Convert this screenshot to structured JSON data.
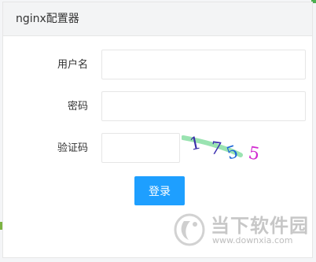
{
  "header": {
    "title": "nginx配置器"
  },
  "form": {
    "username_label": "用户名",
    "username_value": "",
    "password_label": "密码",
    "password_value": "",
    "captcha_label": "验证码",
    "captcha_value": "",
    "captcha_text": [
      "1",
      "7",
      "5",
      "5"
    ],
    "login_label": "登录"
  },
  "watermark": {
    "title": "当下软件园",
    "url": "www.downxia.com"
  },
  "colors": {
    "primary_button": "#1e9fff",
    "header_bg": "#f3f4f5"
  }
}
